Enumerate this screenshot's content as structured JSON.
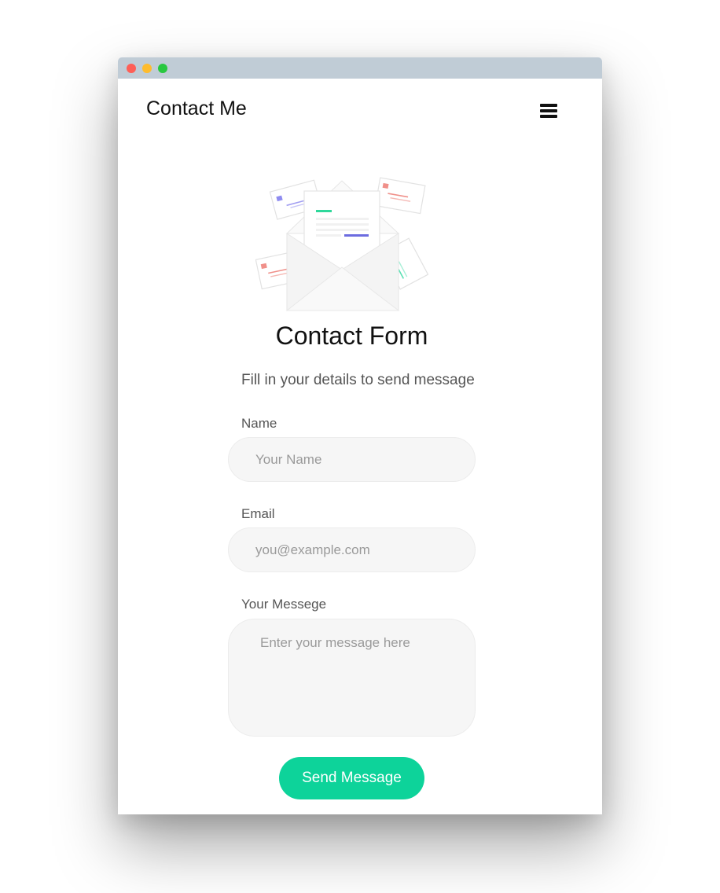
{
  "header": {
    "brand": "Contact Me",
    "menu_icon": "hamburger-menu-icon"
  },
  "illustration": {
    "icon": "open-envelope-with-letters-illustration"
  },
  "form": {
    "title": "Contact Form",
    "subtitle": "Fill in your details to send message",
    "name_label": "Name",
    "name_placeholder": "Your Name",
    "email_label": "Email",
    "email_placeholder": "you@example.com",
    "message_label": "Your Messege",
    "message_placeholder": "Enter your message here",
    "submit_label": "Send Message"
  },
  "colors": {
    "accent": "#0dd39a",
    "titlebar": "#c0ccd6",
    "input_bg": "#f6f6f6"
  }
}
